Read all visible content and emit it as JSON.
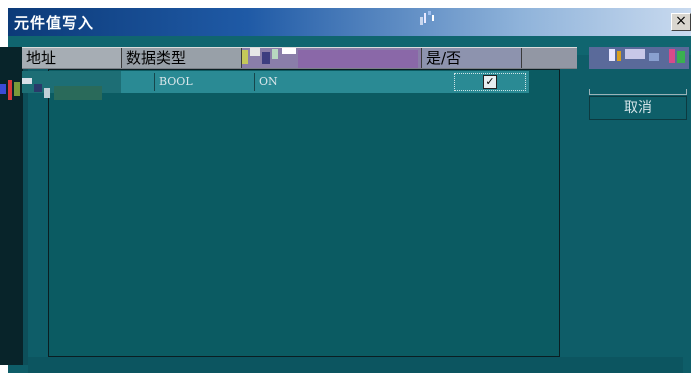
{
  "window": {
    "title": "元件值写入",
    "close_label": "×"
  },
  "table": {
    "headers": {
      "address": "地址",
      "data_type": "数据类型",
      "value": "是/否"
    },
    "rows": [
      {
        "address": "",
        "data_type": "BOOL",
        "value": "ON",
        "checked": true
      }
    ]
  },
  "buttons": {
    "cancel": "取消"
  },
  "colors": {
    "dialog_bg": "#0e5d68",
    "table_bg": "#0b5b62",
    "selected_row": "#2a8a94",
    "titlebar_start": "#0c3a78"
  }
}
